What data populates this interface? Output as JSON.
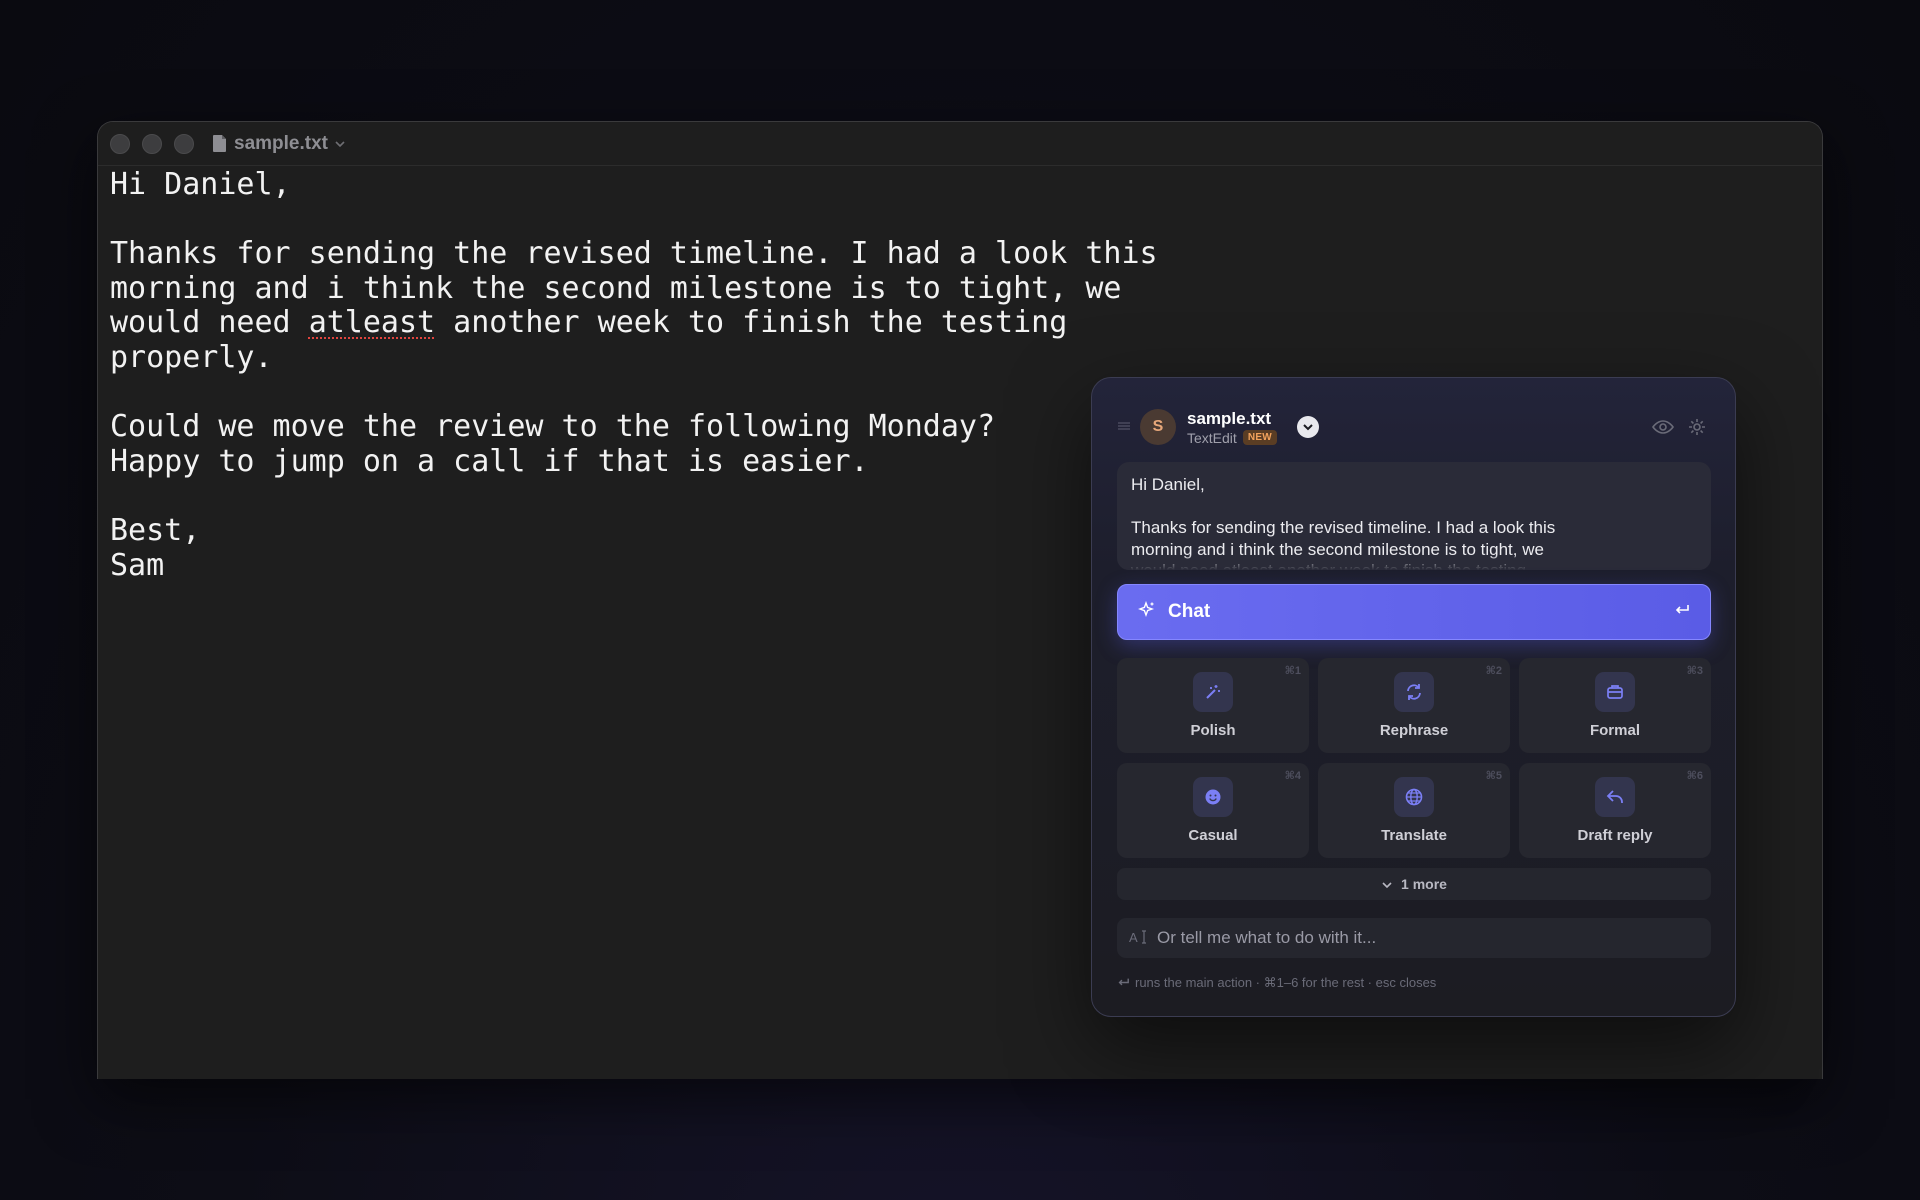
{
  "window": {
    "title": "sample.txt"
  },
  "document": {
    "lines": [
      "Hi Daniel,",
      "",
      "Thanks for sending the revised timeline. I had a look this",
      "morning and i think the second milestone is to tight, we",
      "would need ",
      "properly.",
      "",
      "Could we move the review to the following Monday?",
      "Happy to jump on a call if that is easier.",
      "",
      "Best,",
      "Sam"
    ],
    "misspelled_word": "atleast",
    "line5_rest": " another week to finish the testing"
  },
  "panel": {
    "avatar_letter": "S",
    "file_name": "sample.txt",
    "app_name": "TextEdit",
    "badge": "NEW",
    "preview_lines": [
      "Hi Daniel,",
      "",
      "Thanks for sending the revised timeline. I had a look this",
      "morning and i think the second milestone is to tight, we",
      "would need atleast another week to finish the testing"
    ],
    "chat_label": "Chat",
    "actions": [
      {
        "label": "Polish",
        "shortcut": "⌘1",
        "icon": "magic-wand-icon"
      },
      {
        "label": "Rephrase",
        "shortcut": "⌘2",
        "icon": "refresh-icon"
      },
      {
        "label": "Formal",
        "shortcut": "⌘3",
        "icon": "briefcase-icon"
      },
      {
        "label": "Casual",
        "shortcut": "⌘4",
        "icon": "smiley-icon"
      },
      {
        "label": "Translate",
        "shortcut": "⌘5",
        "icon": "globe-icon"
      },
      {
        "label": "Draft reply",
        "shortcut": "⌘6",
        "icon": "reply-icon"
      }
    ],
    "more_label": "1 more",
    "prompt_placeholder": "Or tell me what to do with it...",
    "hint": "runs the main action · ⌘1–6 for the rest · esc closes"
  },
  "colors": {
    "accent": "#5f61ea",
    "icon_tint": "#7b7ff5",
    "badge_text": "#f2a25c"
  }
}
